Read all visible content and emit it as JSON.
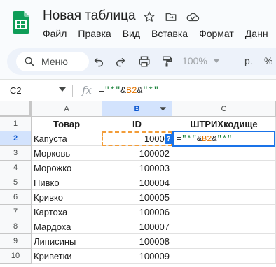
{
  "app": {
    "doc_title": "Новая таблица",
    "menu": [
      "Файл",
      "Правка",
      "Вид",
      "Вставка",
      "Формат",
      "Данн"
    ]
  },
  "toolbar": {
    "search_label": "Меню",
    "zoom": "100%",
    "currency": "р.",
    "percent": "%"
  },
  "formula_bar": {
    "cell_ref": "C2",
    "fx": "fx",
    "formula_parts": [
      {
        "text": "=",
        "kind": "op"
      },
      {
        "text": "\"*\"",
        "kind": "str"
      },
      {
        "text": "&",
        "kind": "op"
      },
      {
        "text": "B2",
        "kind": "ref"
      },
      {
        "text": "&",
        "kind": "op"
      },
      {
        "text": "\"*\"",
        "kind": "str"
      }
    ]
  },
  "grid": {
    "columns": [
      "A",
      "B",
      "C"
    ],
    "selected_column": "B",
    "rows": [
      {
        "n": "1",
        "a": "Товар",
        "b": "ID",
        "c": "ШТРИХкодище"
      },
      {
        "n": "2",
        "a": "Капуста",
        "b": "100001",
        "c": ""
      },
      {
        "n": "3",
        "a": "Морковь",
        "b": "100002",
        "c": ""
      },
      {
        "n": "4",
        "a": "Морожко",
        "b": "100003",
        "c": ""
      },
      {
        "n": "5",
        "a": "Пивко",
        "b": "100004",
        "c": ""
      },
      {
        "n": "6",
        "a": "Кривко",
        "b": "100005",
        "c": ""
      },
      {
        "n": "7",
        "a": "Картоха",
        "b": "100006",
        "c": ""
      },
      {
        "n": "8",
        "a": "Мардоха",
        "b": "100007",
        "c": ""
      },
      {
        "n": "9",
        "a": "Липисины",
        "b": "100008",
        "c": ""
      },
      {
        "n": "10",
        "a": "Криветки",
        "b": "100009",
        "c": ""
      }
    ],
    "b2_visible": "10000",
    "help_badge": "?",
    "colors": {
      "string": "#188038",
      "reference": "#e37400",
      "selection": "#1a73e8",
      "copy_border": "#f29c38"
    }
  }
}
